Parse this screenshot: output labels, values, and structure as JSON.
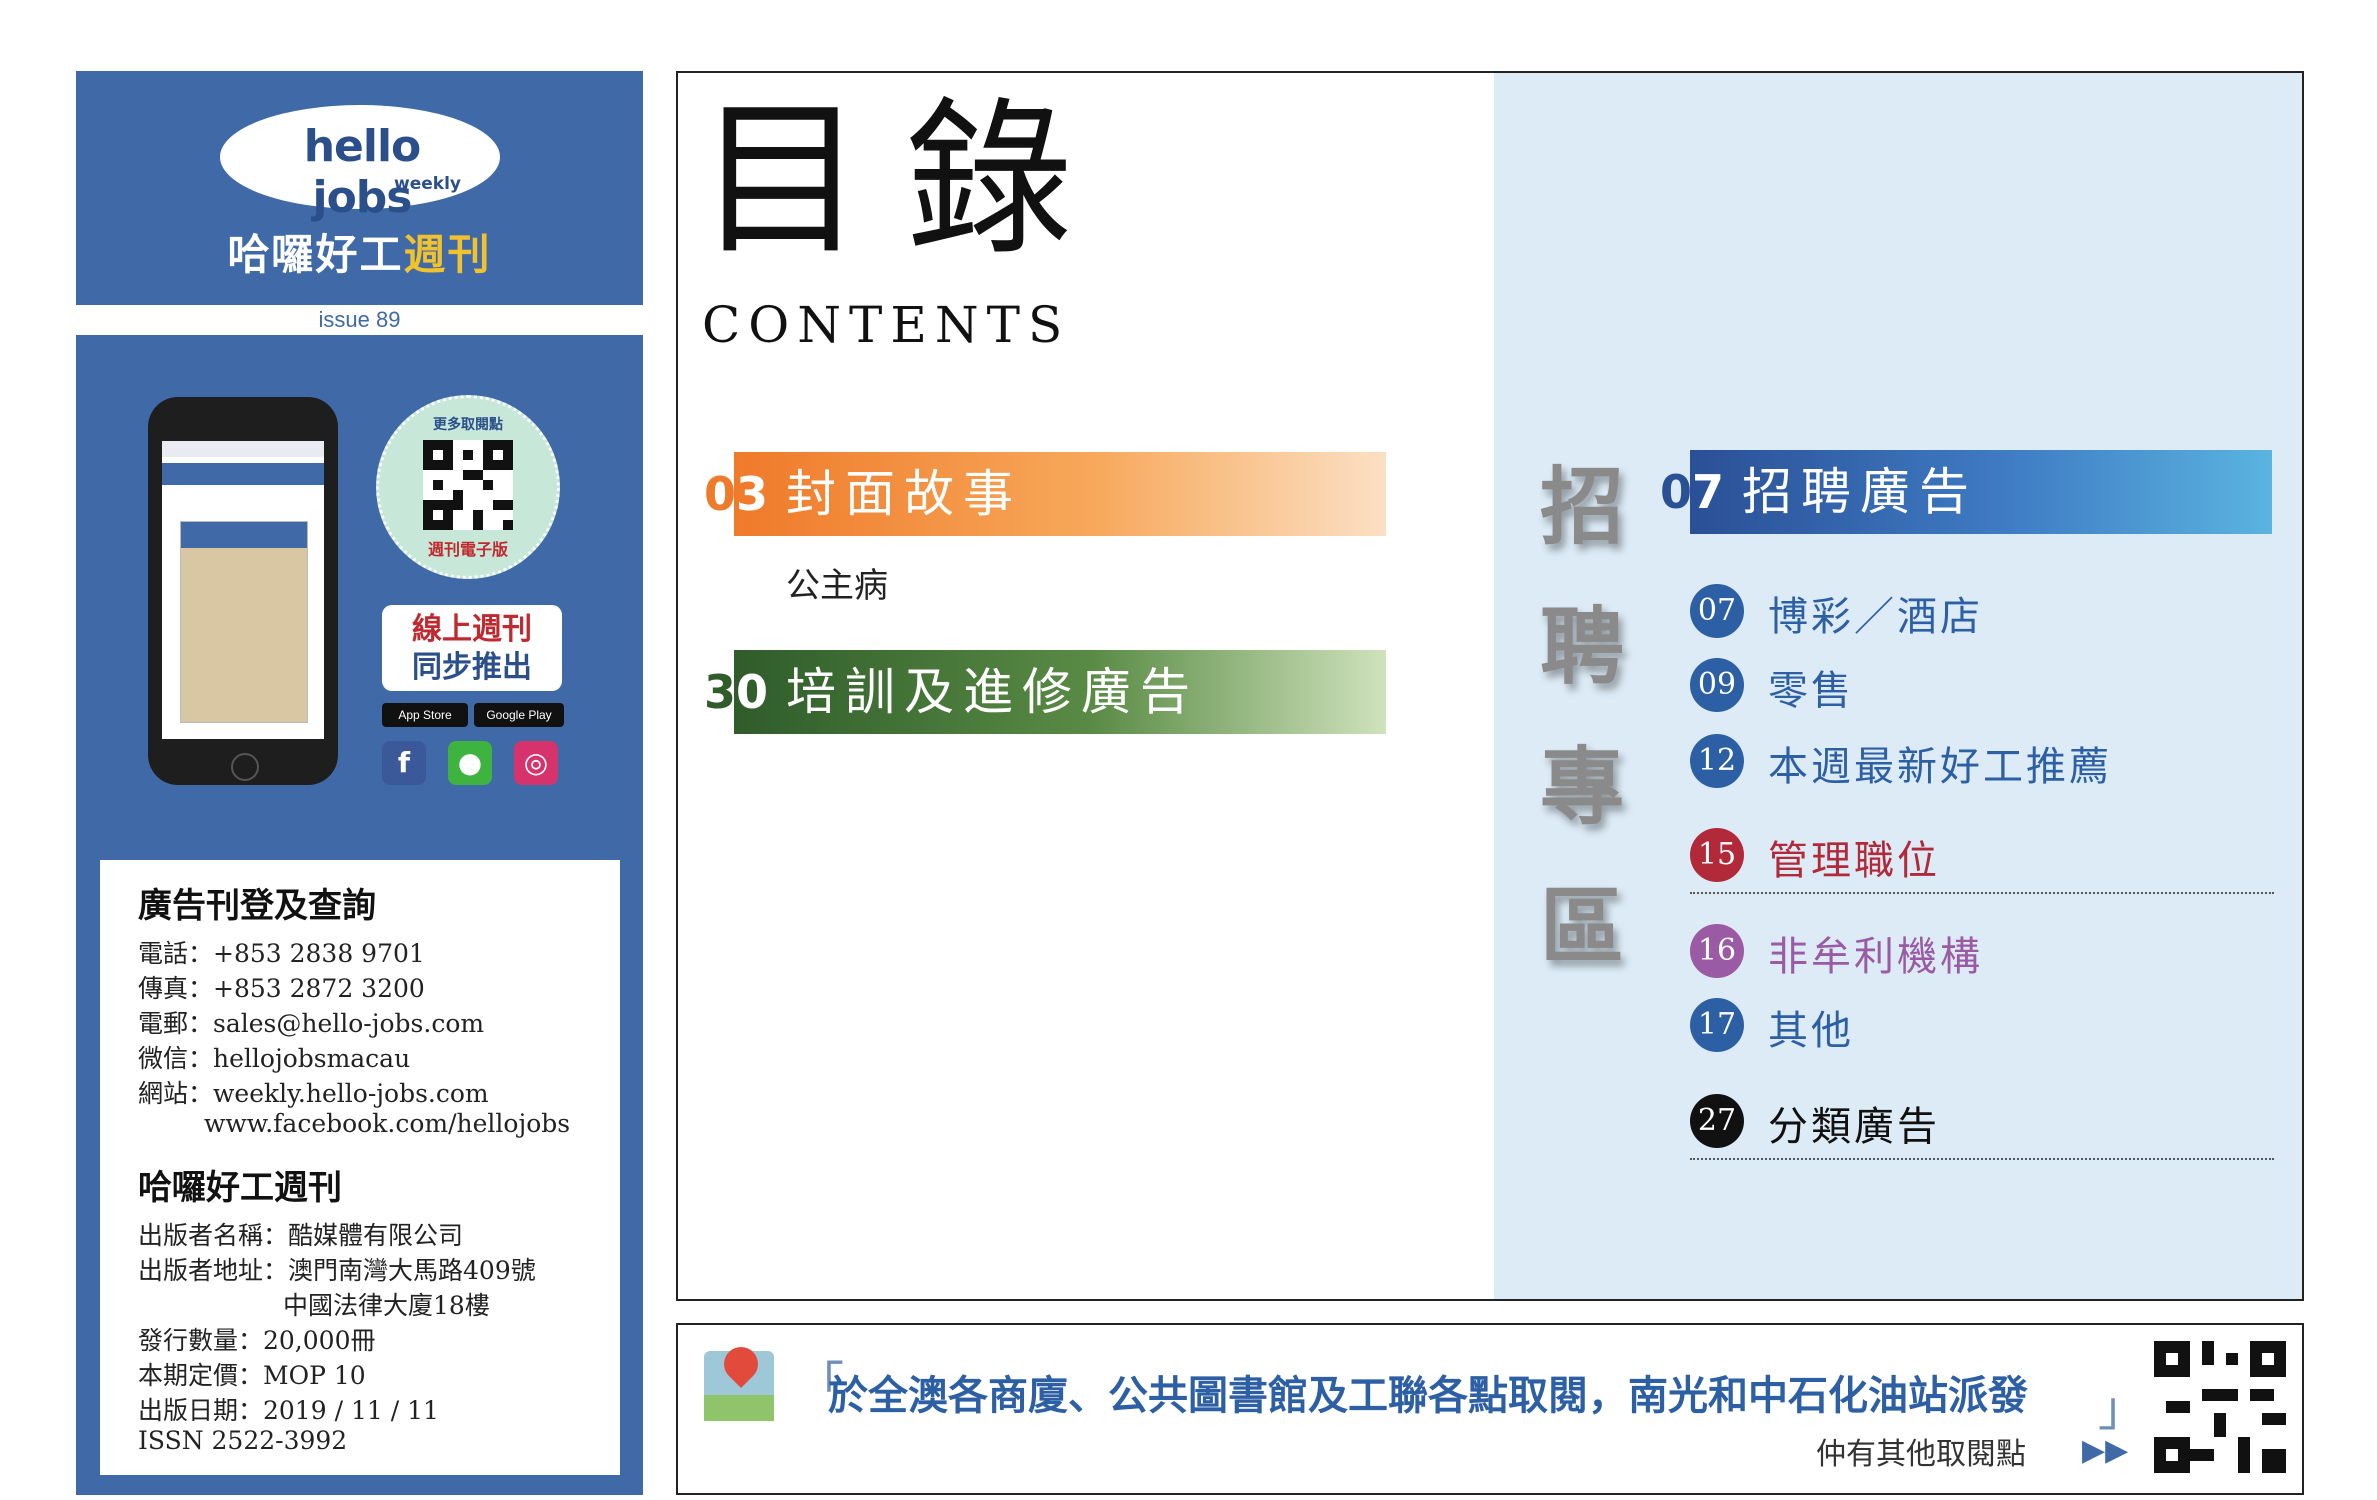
{
  "brand": {
    "logo_main": "hello jobs",
    "logo_sub": "weekly",
    "name_part1": "哈囉好工",
    "name_part2": "週刊",
    "issue": "issue 89"
  },
  "promo": {
    "qr_top_text": "更多取閱點",
    "qr_bottom_text": "週刊電子版",
    "online_line1": "線上週刊",
    "online_line2": "同步推出",
    "app_store": "App Store",
    "google_play": "Google Play",
    "social_icons": [
      "facebook-icon",
      "wechat-icon",
      "instagram-icon"
    ]
  },
  "contact": {
    "heading": "廣告刊登及查詢",
    "lines": [
      "電話：+853 2838 9701",
      "傳真：+853 2872 3200",
      "電郵：sales@hello-jobs.com",
      "微信：hellojobsmacau",
      "網站：weekly.hello-jobs.com",
      "www.facebook.com/hellojobs"
    ]
  },
  "publisher": {
    "heading": "哈囉好工週刊",
    "lines": [
      "出版者名稱：酷媒體有限公司",
      "出版者地址：澳門南灣大馬路409號",
      "中國法律大廈18樓",
      "發行數量：20,000冊",
      "本期定價：MOP 10",
      "出版日期：2019 / 11 / 11",
      "ISSN 2522-3992"
    ]
  },
  "contents": {
    "title_zh": "目錄",
    "title_en": "CONTENTS",
    "sections": [
      {
        "page": "03",
        "label": "封面故事",
        "sub": "公主病"
      },
      {
        "page": "30",
        "label": "培訓及進修廣告"
      }
    ]
  },
  "recruit": {
    "vertical_title": [
      "招",
      "聘",
      "專",
      "區"
    ],
    "header": {
      "page": "07",
      "label": "招聘廣告"
    },
    "items": [
      {
        "page": "07",
        "label": "博彩／酒店"
      },
      {
        "page": "09",
        "label": "零售"
      },
      {
        "page": "12",
        "label": "本週最新好工推薦"
      },
      {
        "page": "15",
        "label": "管理職位"
      },
      {
        "page": "16",
        "label": "非牟利機構"
      },
      {
        "page": "17",
        "label": "其他"
      },
      {
        "page": "27",
        "label": "分類廣告"
      }
    ],
    "colors": {
      "blue": "#2d5fa4",
      "red": "#b2293a",
      "purple": "#9a5aa4",
      "black": "#111111"
    }
  },
  "banner": {
    "text": "於全澳各商廈、公共圖書館及工聯各點取閱，南光和中石化油站派發",
    "more": "仲有其他取閱點"
  }
}
